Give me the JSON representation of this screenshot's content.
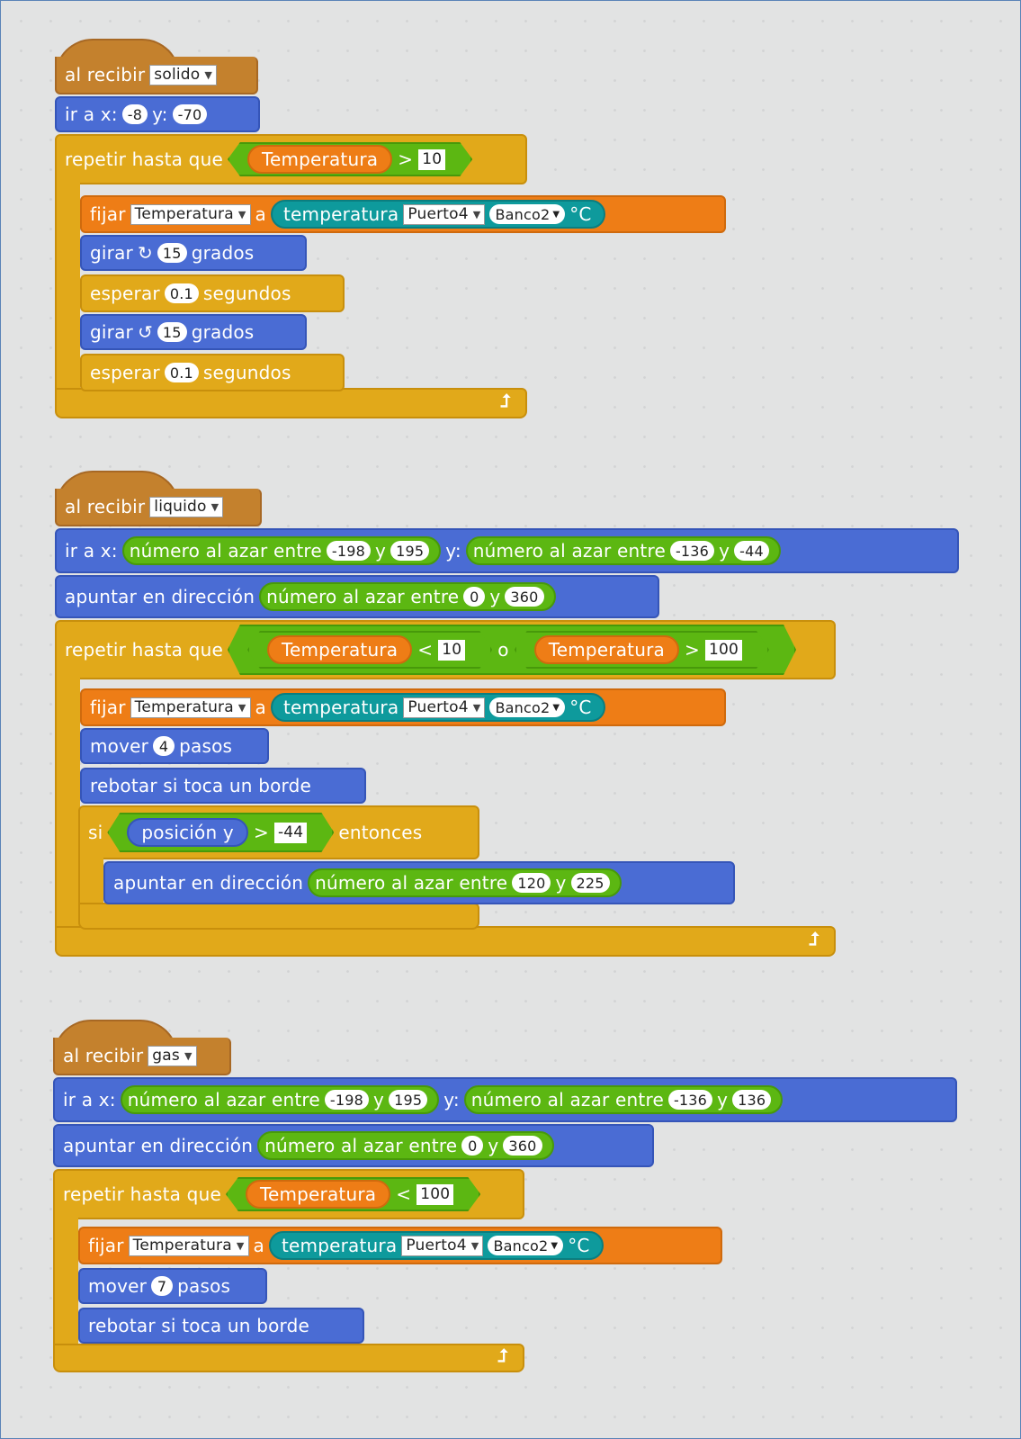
{
  "colors": {
    "events": "#c4812d",
    "motion": "#4a6cd4",
    "control": "#e1a91a",
    "data": "#ee7d16",
    "operators": "#5cb712",
    "sensing": "#0e9a9c",
    "canvas": "#e2e3e3"
  },
  "labels": {
    "when_receive": "al recibir",
    "go_to_x": "ir a x:",
    "y_colon": "y:",
    "repeat_until": "repetir hasta que",
    "set": "fijar",
    "to": "a",
    "temperature_sensor": "temperatura",
    "celsius": "°C",
    "turn": "girar",
    "degrees": "grados",
    "wait": "esperar",
    "seconds": "segundos",
    "random_between": "número al azar entre",
    "and_y": "y",
    "point_direction": "apuntar en dirección",
    "or": "o",
    "move": "mover",
    "steps": "pasos",
    "bounce": "rebotar si toca un borde",
    "if": "si",
    "then": "entonces",
    "position_y": "posición y",
    "gt": ">",
    "lt": "<"
  },
  "var_name": "Temperatura",
  "port": "Puerto4",
  "bank": "Banco2",
  "script1": {
    "message": "solido",
    "goto_x": "-8",
    "goto_y": "-70",
    "cond_value": "10",
    "turn_right": "15",
    "wait1": "0.1",
    "turn_left": "15",
    "wait2": "0.1"
  },
  "script2": {
    "message": "liquido",
    "x_from": "-198",
    "x_to": "195",
    "y_from": "-136",
    "y_to": "-44",
    "dir_from": "0",
    "dir_to": "360",
    "cond1_value": "10",
    "cond2_value": "100",
    "move_steps": "4",
    "if_value": "-44",
    "if_dir_from": "120",
    "if_dir_to": "225"
  },
  "script3": {
    "message": "gas",
    "x_from": "-198",
    "x_to": "195",
    "y_from": "-136",
    "y_to": "136",
    "dir_from": "0",
    "dir_to": "360",
    "cond_value": "100",
    "move_steps": "7"
  }
}
